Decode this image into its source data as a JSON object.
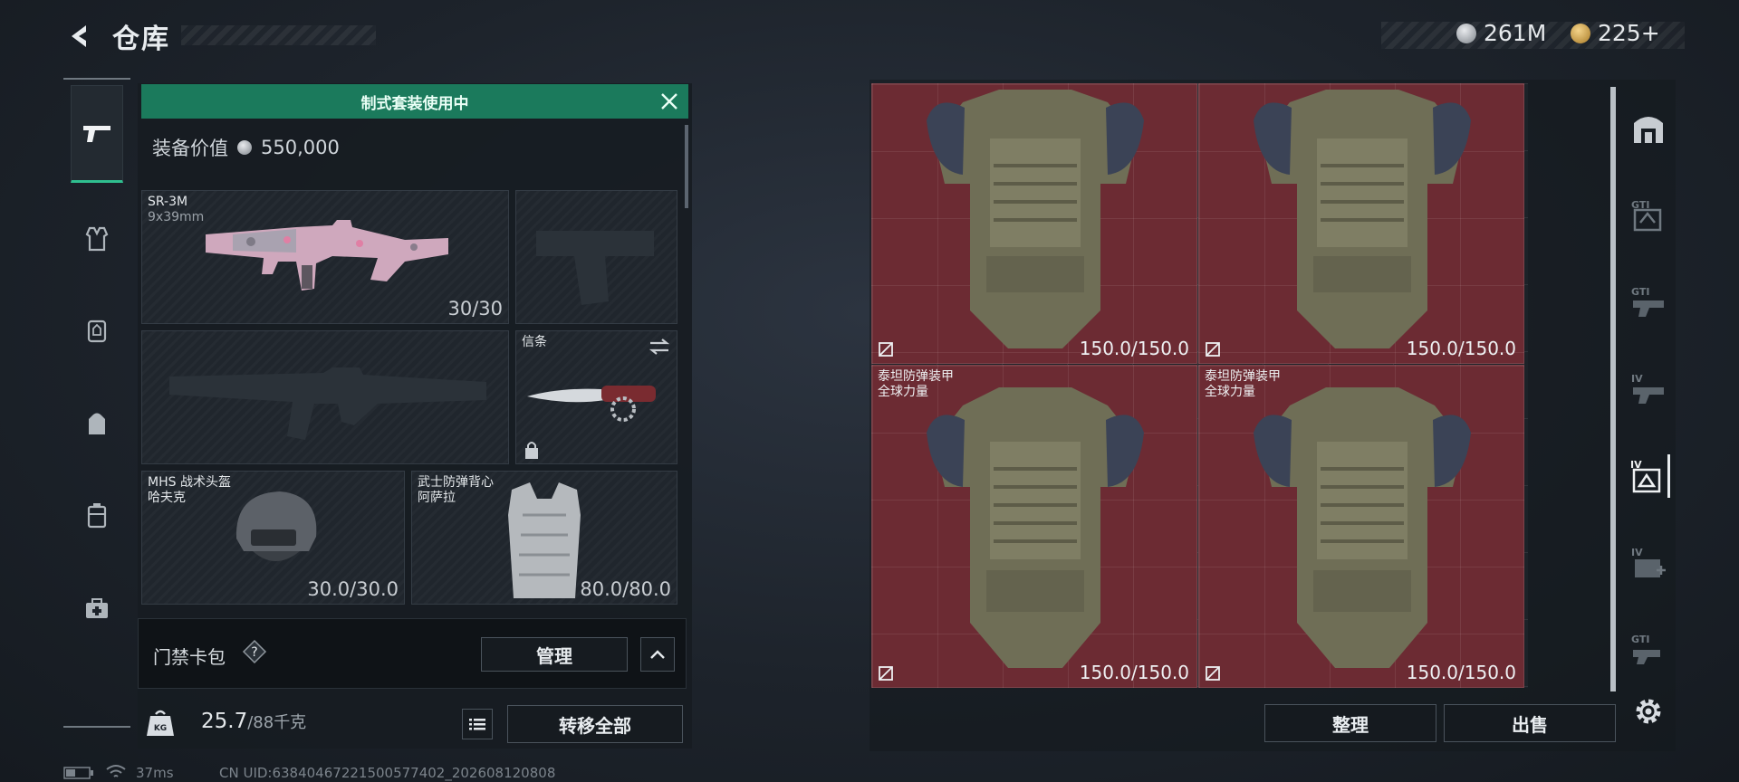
{
  "header": {
    "title": "仓库",
    "currencies": [
      {
        "icon": "silver-coin-icon",
        "value": "261M"
      },
      {
        "icon": "gold-coin-icon",
        "value": "225+"
      }
    ]
  },
  "left_nav": {
    "items": [
      {
        "icon": "pistol-icon",
        "active": true
      },
      {
        "icon": "vest-icon",
        "active": false
      },
      {
        "icon": "armor-rig-icon",
        "active": false
      },
      {
        "icon": "backpack-icon",
        "active": false
      },
      {
        "icon": "container-icon",
        "active": false
      },
      {
        "icon": "medkit-icon",
        "active": false
      }
    ]
  },
  "loadout": {
    "banner": "制式套装使用中",
    "value_label": "装备价值",
    "value": "550,000",
    "primary_weapon": {
      "name": "SR-3M",
      "caliber": "9x39mm",
      "ammo": "30/30"
    },
    "melee": {
      "name": "信条"
    },
    "helmet": {
      "name": "MHS 战术头盔",
      "sub": "哈夫克",
      "durability": "30.0/30.0"
    },
    "vest": {
      "name": "武士防弹背心",
      "sub": "阿萨拉",
      "durability": "80.0/80.0"
    },
    "keycard": {
      "label": "门禁卡包",
      "help": "?",
      "manage": "管理"
    },
    "weight": {
      "current": "25.7",
      "max": "/88千克"
    },
    "transfer_all": "转移全部"
  },
  "status_bar": {
    "ping": "37ms",
    "uid": "CN UID:63840467221500577402_202608120808"
  },
  "storage": {
    "items": [
      {
        "name": "",
        "sub": "",
        "durability": "150.0/150.0"
      },
      {
        "name": "",
        "sub": "",
        "durability": "150.0/150.0"
      },
      {
        "name": "泰坦防弹装甲",
        "sub": "全球力量",
        "durability": "150.0/150.0"
      },
      {
        "name": "泰坦防弹装甲",
        "sub": "全球力量",
        "durability": "150.0/150.0"
      }
    ],
    "sort_label": "整理",
    "sell_label": "出售"
  },
  "right_nav": {
    "items": [
      {
        "icon": "storage-vault-icon",
        "label": ""
      },
      {
        "icon": "helmet-filter-icon",
        "label": "GTI"
      },
      {
        "icon": "weapon-filter-icon",
        "label": "GTI"
      },
      {
        "icon": "armor-filter-icon",
        "label": "IV"
      },
      {
        "icon": "armor-tier-icon",
        "label": "IV",
        "active": true
      },
      {
        "icon": "med-filter-icon",
        "label": "IV"
      },
      {
        "icon": "gear-filter-icon",
        "label": "GTI"
      }
    ],
    "settings": "settings-gear-icon"
  },
  "colors": {
    "accent_green": "#1b7a5c",
    "item_bg": "#6c2b33",
    "active_underline": "#2fbf8f"
  }
}
